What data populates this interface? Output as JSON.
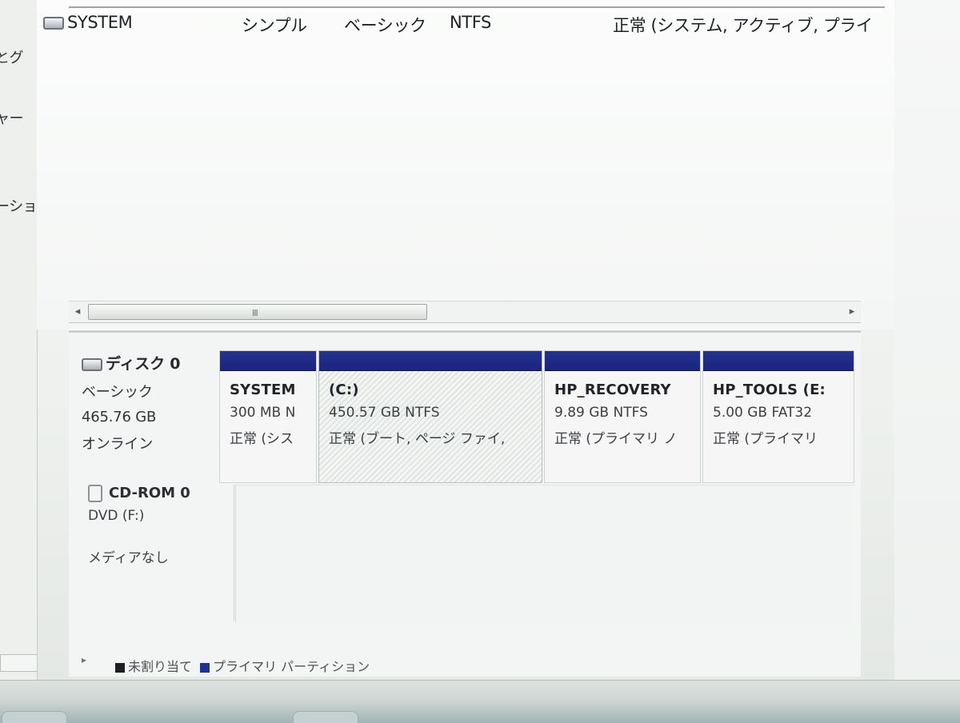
{
  "left_nav": {
    "items": [
      {
        "label": "とグ"
      },
      {
        "label": "ャー"
      },
      {
        "label": "ーショ"
      }
    ]
  },
  "volume_list": {
    "visible_row": {
      "name": "SYSTEM",
      "layout": "シンプル",
      "type": "ベーシック",
      "file_system": "NTFS",
      "status": "正常 (システム, アクティブ, プライ"
    }
  },
  "scrollbar": {
    "left_arrow": "◂",
    "right_arrow": "▸",
    "thumb_grip": "III"
  },
  "disk0": {
    "title": "ディスク 0",
    "type": "ベーシック",
    "size": "465.76 GB",
    "status": "オンライン",
    "partitions": [
      {
        "name": "SYSTEM",
        "detail": "300 MB N",
        "status": "正常 (シス"
      },
      {
        "name": "(C:)",
        "detail": "450.57 GB NTFS",
        "status": "正常 (ブート, ページ ファイ,"
      },
      {
        "name": "HP_RECOVERY",
        "detail": "9.89 GB NTFS",
        "status": "正常 (プライマリ ノ"
      },
      {
        "name": "HP_TOOLS  (E:",
        "detail": "5.00 GB FAT32",
        "status": "正常 (プライマリ"
      }
    ]
  },
  "cdrom0": {
    "title": "CD-ROM 0",
    "drive": "DVD (F:)",
    "media": "メディアなし"
  },
  "legend": {
    "unallocated": "未割り当て",
    "primary_partition": "プライマリ パーティション"
  },
  "colors": {
    "partition_header": "#1f2a8c",
    "legend_unallocated": "#1d1f22",
    "legend_primary": "#1f2f95"
  },
  "icons": {
    "disk": "disk-icon",
    "cdrom": "cd-rom-icon",
    "scroll_left": "scroll-left-icon",
    "scroll_right": "scroll-right-icon"
  }
}
